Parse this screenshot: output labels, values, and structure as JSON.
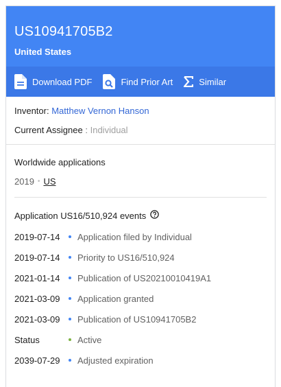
{
  "header": {
    "patent_number": "US10941705B2",
    "country": "United States"
  },
  "toolbar": {
    "download_label": "Download PDF",
    "prior_art_label": "Find Prior Art",
    "similar_label": "Similar"
  },
  "people": {
    "inventor_label": "Inventor:",
    "inventor_name": "Matthew Vernon Hanson",
    "assignee_label": "Current Assignee",
    "assignee_sep": ":",
    "assignee_value": "Individual"
  },
  "worldwide": {
    "title": "Worldwide applications",
    "year": "2019",
    "country_link": "US"
  },
  "events": {
    "title": "Application US16/510,924 events",
    "items": [
      {
        "date": "2019-07-14",
        "text": "Application filed by Individual",
        "status": "blue"
      },
      {
        "date": "2019-07-14",
        "text": "Priority to US16/510,924",
        "status": "blue"
      },
      {
        "date": "2021-01-14",
        "text": "Publication of US20210010419A1",
        "status": "blue"
      },
      {
        "date": "2021-03-09",
        "text": "Application granted",
        "status": "blue"
      },
      {
        "date": "2021-03-09",
        "text": "Publication of US10941705B2",
        "status": "blue"
      },
      {
        "date": "Status",
        "text": "Active",
        "status": "green"
      },
      {
        "date": "2039-07-29",
        "text": "Adjusted expiration",
        "status": "blue"
      }
    ]
  },
  "colors": {
    "header_bg": "#4285f4",
    "toolbar_bg": "#3b78e7",
    "link": "#3367d6",
    "active_dot": "#7cb342"
  }
}
